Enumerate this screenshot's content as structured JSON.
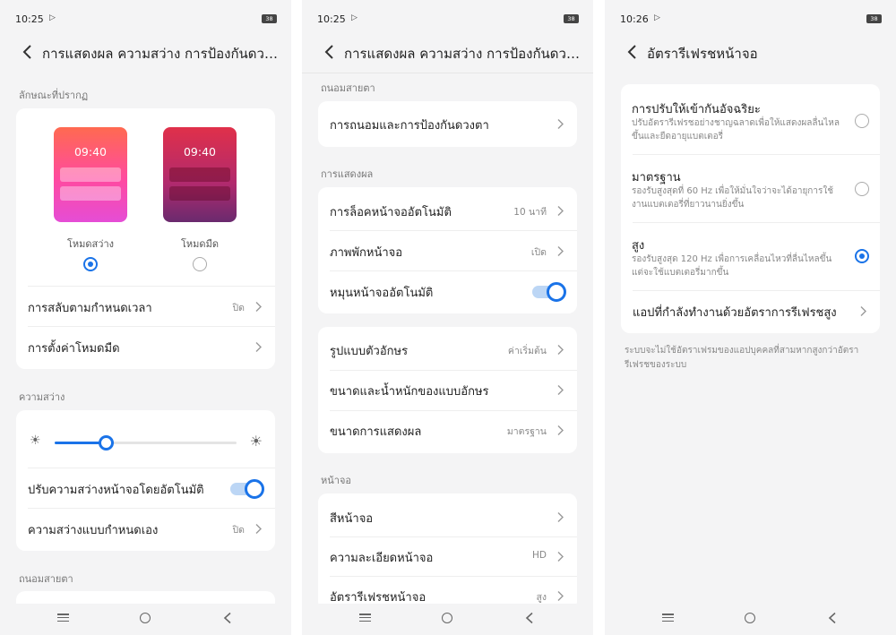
{
  "colors": {
    "accent": "#1a73e8",
    "bg": "#f4f4f5"
  },
  "screen1": {
    "time": "10:25",
    "battery": "38",
    "title": "การแสดงผล ความสว่าง การป้องกันดวงตา",
    "appearance_label": "ลักษณะที่ปรากฏ",
    "preview_time": "09:40",
    "light_mode": "โหมดสว่าง",
    "dark_mode": "โหมดมืด",
    "selected_mode": "light",
    "schedule_switch": {
      "label": "การสลับตามกำหนดเวลา",
      "value": "ปิด"
    },
    "dark_settings": {
      "label": "การตั้งค่าโหมดมืด"
    },
    "brightness_label": "ความสว่าง",
    "brightness_level": 0.28,
    "auto_brightness": {
      "label": "ปรับความสว่างหน้าจอโดยอัตโนมัติ",
      "on": true
    },
    "manual_brightness": {
      "label": "ความสว่างแบบกำหนดเอง",
      "value": "ปิด"
    },
    "eye_label": "ถนอมสายตา"
  },
  "screen2": {
    "time": "10:25",
    "battery": "38",
    "title": "การแสดงผล ความสว่าง การป้องกันดวงตา",
    "eye_label": "ถนอมสายตา",
    "eye_item": "การถนอมและการป้องกันดวงตา",
    "display_label": "การแสดงผล",
    "auto_lock": {
      "label": "การล็อคหน้าจออัตโนมัติ",
      "value": "10 นาที"
    },
    "screensaver": {
      "label": "ภาพพักหน้าจอ",
      "value": "เปิด"
    },
    "auto_rotate": {
      "label": "หมุนหน้าจออัตโนมัติ",
      "on": true
    },
    "font_style": {
      "label": "รูปแบบตัวอักษร",
      "value": "ค่าเริ่มต้น"
    },
    "font_size": {
      "label": "ขนาดและน้ำหนักของแบบอักษร"
    },
    "display_size": {
      "label": "ขนาดการแสดงผล",
      "value": "มาตรฐาน"
    },
    "screen_label": "หน้าจอ",
    "screen_color": {
      "label": "สีหน้าจอ"
    },
    "resolution": {
      "label": "ความละเอียดหน้าจอ",
      "value": "HD"
    },
    "refresh_rate": {
      "label": "อัตรารีเฟรชหน้าจอ",
      "value": "สูง"
    }
  },
  "screen3": {
    "time": "10:26",
    "battery": "38",
    "title": "อัตรารีเฟรชหน้าจอ",
    "options": [
      {
        "title": "การปรับให้เข้ากันอัจฉริยะ",
        "desc": "ปรับอัตรารีเฟรชอย่างชาญฉลาดเพื่อให้แสดงผลลื่นไหลขึ้นและยืดอายุแบตเตอรี่",
        "selected": false
      },
      {
        "title": "มาตรฐาน",
        "desc": "รองรับสูงสุดที่ 60 Hz เพื่อให้มั่นใจว่าจะได้อายุการใช้งานแบตเตอรี่ที่ยาวนานยิ่งขึ้น",
        "selected": false
      },
      {
        "title": "สูง",
        "desc": "รองรับสูงสุด 120 Hz เพื่อการเคลื่อนไหวที่ลื่นไหลขึ้น แต่จะใช้แบตเตอรี่มากขึ้น",
        "selected": true
      }
    ],
    "apps_item": "แอปที่กำลังทำงานด้วยอัตราการรีเฟรชสูง",
    "footnote": "ระบบจะไม่ใช้อัตราเฟรมของแอปบุคคลที่สามหากสูงกว่าอัตรารีเฟรชของระบบ"
  }
}
